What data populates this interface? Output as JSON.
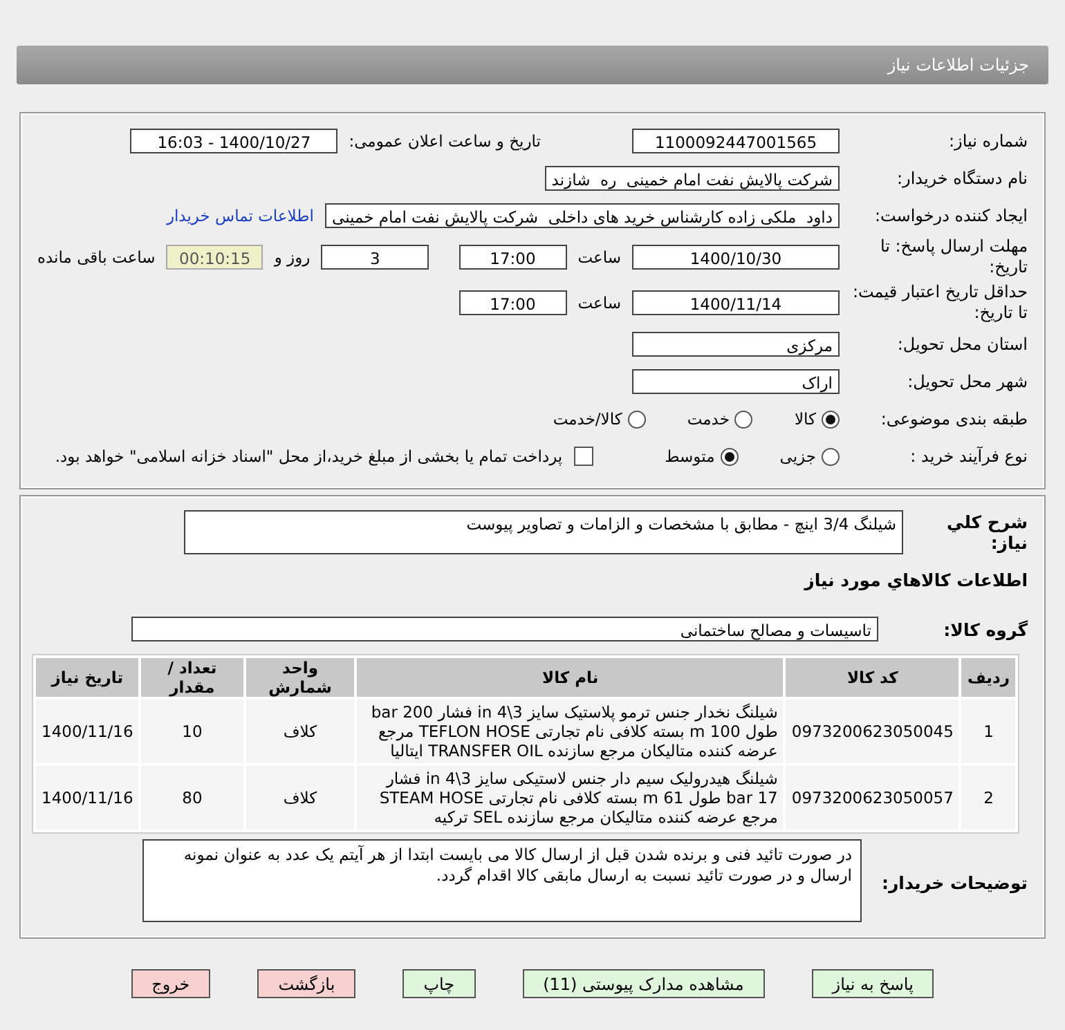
{
  "title": "جزئیات اطلاعات نیاز",
  "need_number": {
    "label": "شماره نیاز:",
    "value": "1100092447001565"
  },
  "announce": {
    "label": "تاریخ و ساعت اعلان عمومی:",
    "value": "1400/10/27 - 16:03"
  },
  "buyer": {
    "label": "نام دستگاه خریدار:",
    "value": "شرکت پالایش نفت امام خمینی  ره  شازند"
  },
  "creator": {
    "label": "ایجاد کننده درخواست:",
    "value": "داود  ملکی زاده کارشناس خرید های داخلی  شرکت پالایش نفت امام خمینی",
    "link": "اطلاعات تماس خریدار"
  },
  "deadline": {
    "label": "مهلت ارسال پاسخ: تا تاریخ:",
    "date": "1400/10/30",
    "time_label": "ساعت",
    "time": "17:00",
    "days": "3",
    "days_label": "روز و",
    "remaining": "00:10:15",
    "remaining_label": "ساعت باقی مانده"
  },
  "validity": {
    "label": "حداقل تاریخ اعتبار قیمت: تا تاریخ:",
    "date": "1400/11/14",
    "time_label": "ساعت",
    "time": "17:00"
  },
  "province": {
    "label": "استان محل تحویل:",
    "value": "مرکزی"
  },
  "city": {
    "label": "شهر محل تحویل:",
    "value": "اراک"
  },
  "category": {
    "label": "طبقه بندی موضوعی:",
    "options": [
      {
        "label": "کالا",
        "selected": true
      },
      {
        "label": "خدمت",
        "selected": false
      },
      {
        "label": "کالا/خدمت",
        "selected": false
      }
    ]
  },
  "process": {
    "label": "نوع فرآیند خرید :",
    "options": [
      {
        "label": "جزیی",
        "selected": false
      },
      {
        "label": "متوسط",
        "selected": true
      }
    ],
    "payment": {
      "label": "پرداخت تمام یا بخشی از مبلغ خرید،از محل \"اسناد خزانه اسلامی\" خواهد بود.",
      "checked": false
    }
  },
  "description": {
    "label": "شرح کلي نياز:",
    "value": "شیلنگ 3/4 اینچ - مطابق با مشخصات و الزامات و تصاویر پیوست"
  },
  "goods_title": "اطلاعات کالاهاي مورد نياز",
  "group": {
    "label": "گروه کالا:",
    "value": "تاسیسات و مصالح ساختمانی"
  },
  "table": {
    "columns": [
      "ردیف",
      "کد کالا",
      "نام کالا",
      "واحد شمارش",
      "تعداد / مقدار",
      "تاریخ نیاز"
    ],
    "rows": [
      [
        "1",
        "0973200623050045",
        "شیلنگ نخدار جنس ترمو پلاستیک سایز 3\\4 in فشار 200 bar طول 100 m بسته کلافی نام تجارتی TEFLON HOSE مرجع عرضه کننده متالیکان مرجع سازنده TRANSFER OIL ایتالیا",
        "کلاف",
        "10",
        "1400/11/16"
      ],
      [
        "2",
        "0973200623050057",
        "شیلنگ هیدرولیک سیم دار جنس لاستیکی سایز 3\\4 in فشار 17 bar طول 61 m بسته کلافی نام تجارتی STEAM HOSE مرجع عرضه کننده متالیکان مرجع سازنده SEL ترکیه",
        "کلاف",
        "80",
        "1400/11/16"
      ]
    ]
  },
  "notes": {
    "label": "توضیحات خریدار:",
    "value": "در صورت تائید فنی و برنده شدن قبل از ارسال کالا می بایست ابتدا از هر آیتم یک عدد به عنوان نمونه ارسال و در صورت تائید نسبت به ارسال مابقی کالا اقدام گردد."
  },
  "buttons": [
    {
      "label": "پاسخ به نیاز",
      "kind": "green"
    },
    {
      "label": "مشاهده مدارک پیوستی (11)",
      "kind": "green"
    },
    {
      "label": "چاپ",
      "kind": "green"
    },
    {
      "label": "بازگشت",
      "kind": "red"
    },
    {
      "label": "خروج",
      "kind": "red"
    }
  ]
}
